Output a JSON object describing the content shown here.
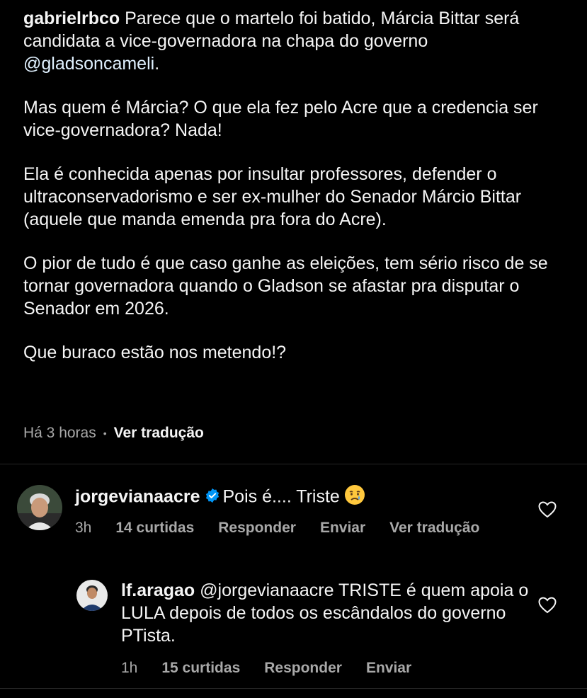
{
  "caption": {
    "username": "gabrielrbco",
    "text_p1": "Parece que o martelo foi batido, Márcia Bittar será candidata a vice-governadora na chapa do governo",
    "mention": "@gladsoncameli",
    "text_p1_end": ".",
    "p2": "Mas quem é Márcia? O que ela fez pelo Acre que a credencia ser vice-governadora? Nada!",
    "p3": "Ela é conhecida apenas por insultar professores, defender o ultraconservadorismo e ser ex-mulher do Senador Márcio Bittar (aquele que manda emenda pra fora do Acre).",
    "p4": "O pior de tudo é que caso ganhe as eleições, tem sério risco de se tornar governadora quando o Gladson se afastar pra disputar o Senador em 2026.",
    "p5": "Que buraco estão nos metendo!?",
    "time": "Há 3 horas",
    "separator": "•",
    "translate": "Ver tradução"
  },
  "comments": [
    {
      "username": "jorgevianaacre",
      "verified": true,
      "text": "Pois é.... Triste",
      "emoji": "crying-face",
      "time": "3h",
      "likes": "14 curtidas",
      "reply": "Responder",
      "send": "Enviar",
      "translate": "Ver tradução"
    },
    {
      "username": "lf.aragao",
      "mention": "@jorgevianaacre",
      "text": "TRISTE é quem apoia o LULA depois de todos os escândalos do governo PTista.",
      "time": "1h",
      "likes": "15 curtidas",
      "reply": "Responder",
      "send": "Enviar"
    }
  ],
  "colors": {
    "background": "#000000",
    "text": "#f5f5f5",
    "muted": "#a8a8a8",
    "verified": "#0095f6"
  }
}
